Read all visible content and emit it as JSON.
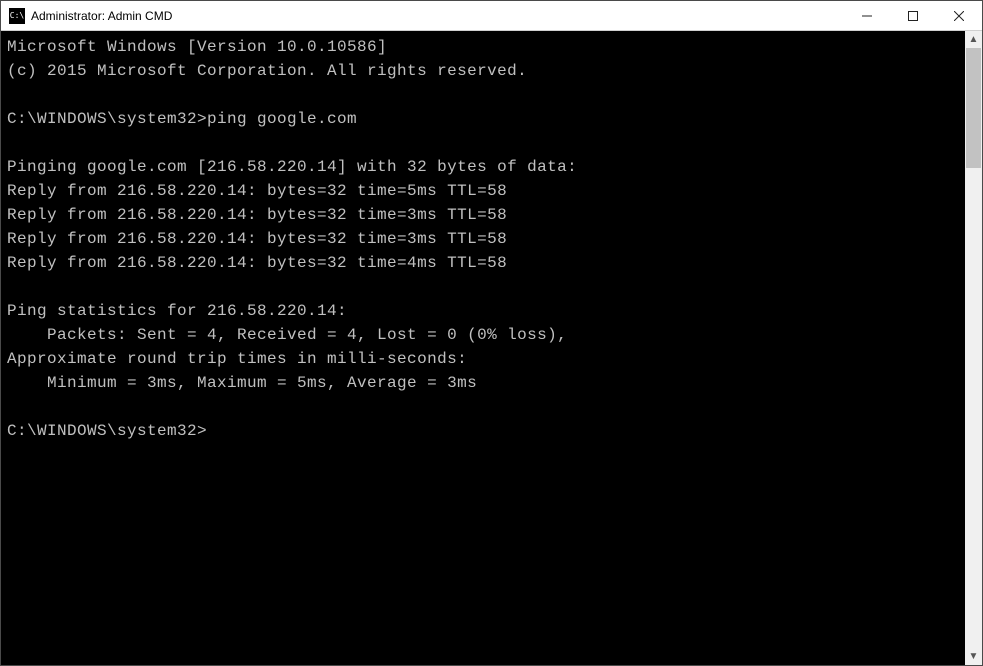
{
  "window": {
    "title": "Administrator: Admin CMD",
    "icon_label": "C:\\"
  },
  "terminal": {
    "lines": [
      "Microsoft Windows [Version 10.0.10586]",
      "(c) 2015 Microsoft Corporation. All rights reserved.",
      "",
      "C:\\WINDOWS\\system32>ping google.com",
      "",
      "Pinging google.com [216.58.220.14] with 32 bytes of data:",
      "Reply from 216.58.220.14: bytes=32 time=5ms TTL=58",
      "Reply from 216.58.220.14: bytes=32 time=3ms TTL=58",
      "Reply from 216.58.220.14: bytes=32 time=3ms TTL=58",
      "Reply from 216.58.220.14: bytes=32 time=4ms TTL=58",
      "",
      "Ping statistics for 216.58.220.14:",
      "    Packets: Sent = 4, Received = 4, Lost = 0 (0% loss),",
      "Approximate round trip times in milli-seconds:",
      "    Minimum = 3ms, Maximum = 5ms, Average = 3ms",
      "",
      "C:\\WINDOWS\\system32>"
    ]
  }
}
